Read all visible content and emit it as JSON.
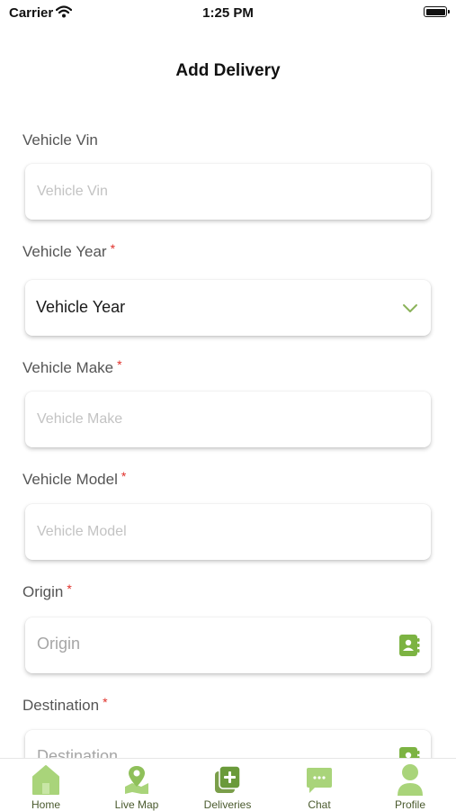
{
  "status_bar": {
    "carrier": "Carrier",
    "time": "1:25 PM"
  },
  "header": {
    "title": "Add Delivery"
  },
  "required_mark": "*",
  "colors": {
    "accent": "#7cb342",
    "accent_dark": "#4a5a2e",
    "required": "#e0302a"
  },
  "form": {
    "vin": {
      "label": "Vehicle Vin",
      "placeholder": "Vehicle Vin"
    },
    "year": {
      "label": "Vehicle Year",
      "value": "Vehicle Year"
    },
    "make": {
      "label": "Vehicle Make",
      "placeholder": "Vehicle Make"
    },
    "model": {
      "label": "Vehicle Model",
      "placeholder": "Vehicle Model"
    },
    "origin": {
      "label": "Origin",
      "placeholder": "Origin",
      "icon": "contact-book-icon"
    },
    "destination": {
      "label": "Destination",
      "placeholder": "Destination",
      "icon": "contact-book-icon"
    }
  },
  "tabs": [
    {
      "label": "Home",
      "icon": "home-icon"
    },
    {
      "label": "Live Map",
      "icon": "map-pin-icon"
    },
    {
      "label": "Deliveries",
      "icon": "add-delivery-icon"
    },
    {
      "label": "Chat",
      "icon": "chat-icon"
    },
    {
      "label": "Profile",
      "icon": "profile-icon"
    }
  ]
}
